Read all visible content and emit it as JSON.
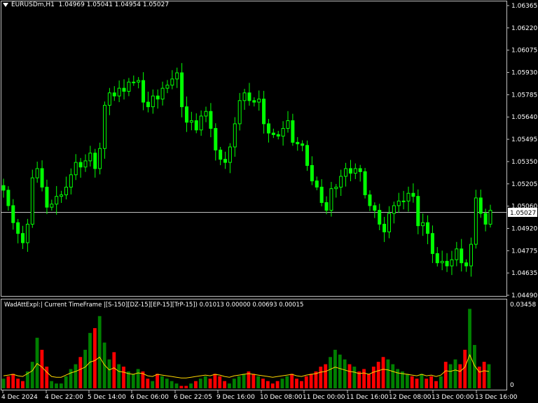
{
  "header": {
    "symbol_label": "EURUSDm,H1",
    "ohlc": "1.04969 1.05041 1.04954 1.05027"
  },
  "indicator_header": "WadAttExpl:| Current TimeFrame |[S-150][DZ-15][EP-15][TrP-15]) 0.01013 0.00000 0.00693 0.00015",
  "price_axis": {
    "labels": [
      "1.06365",
      "1.06220",
      "1.06075",
      "1.05930",
      "1.05785",
      "1.05640",
      "1.05495",
      "1.05350",
      "1.05205",
      "1.05060",
      "1.04920",
      "1.04775",
      "1.04635",
      "1.04490"
    ],
    "current_price": "1.05027"
  },
  "indicator_axis": {
    "top": "0.03458",
    "bottom": "0"
  },
  "time_axis": [
    "4 Dec 2024",
    "4 Dec 22:00",
    "5 Dec 14:00",
    "6 Dec 06:00",
    "6 Dec 22:05",
    "9 Dec 16:00",
    "10 Dec 08:00",
    "11 Dec 00:00",
    "11 Dec 16:00",
    "12 Dec 08:00",
    "13 Dec 00:00",
    "13 Dec 16:00"
  ],
  "colors": {
    "background": "#000000",
    "candle": "#00ff00",
    "bar_up": "#008000",
    "bar_down": "#ff0000",
    "signal_line": "#ffd700",
    "grid_line": "#c0c0c0"
  },
  "chart_data": [
    {
      "type": "line",
      "title": "EURUSDm,H1",
      "x_range": [
        "4 Dec 2024",
        "13 Dec 16:00"
      ],
      "ylim": [
        1.0449,
        1.06365
      ],
      "series": [
        {
          "values": [
            1.0517,
            1.0507,
            1.0496,
            1.0489,
            1.0483,
            1.0495,
            1.0525,
            1.0531,
            1.0519,
            1.0506,
            1.0508,
            1.0513,
            1.0514,
            1.0519,
            1.0527,
            1.0535,
            1.0532,
            1.0536,
            1.0541,
            1.0531,
            1.0544,
            1.0572,
            1.058,
            1.0578,
            1.0583,
            1.0581,
            1.0587,
            1.0587,
            1.0588,
            1.0574,
            1.0571,
            1.0578,
            1.0576,
            1.0583,
            1.0585,
            1.0589,
            1.0593,
            1.0571,
            1.0561,
            1.0562,
            1.0556,
            1.0565,
            1.0568,
            1.0557,
            1.0543,
            1.0537,
            1.0535,
            1.0545,
            1.056,
            1.0575,
            1.058,
            1.0575,
            1.0574,
            1.0576,
            1.056,
            1.0554,
            1.0553,
            1.0552,
            1.0557,
            1.0562,
            1.0548,
            1.0547,
            1.0546,
            1.0533,
            1.0523,
            1.0519,
            1.0509,
            1.0504,
            1.0518,
            1.0519,
            1.0526,
            1.0531,
            1.0528,
            1.0531,
            1.0529,
            1.0514,
            1.0507,
            1.0504,
            1.0495,
            1.049,
            1.0502,
            1.0507,
            1.051,
            1.051,
            1.0515,
            1.0513,
            1.0494,
            1.0496,
            1.0489,
            1.0476,
            1.047,
            1.0471,
            1.0468,
            1.0472,
            1.0479,
            1.047,
            1.0468,
            1.0482,
            1.0512,
            1.0502,
            1.0495,
            1.0504
          ]
        }
      ]
    },
    {
      "type": "bar",
      "title": "WadAttExpl",
      "ylim": [
        0,
        0.03458
      ],
      "series": [
        {
          "name": "up",
          "values": [
            0.004,
            0.005,
            0.006,
            0.004,
            0.003,
            0.007,
            0.011,
            0.021,
            0.016,
            0.009,
            0.003,
            0.002,
            0.002,
            0.005,
            0.008,
            0.01,
            0.013,
            0.016,
            0.023,
            0.025,
            0.03,
            0.019,
            0.012,
            0.015,
            0.01,
            0.009,
            0.007,
            0.006,
            0.008,
            0.007,
            0.004,
            0.003,
            0.006,
            0.005,
            0.004,
            0.003,
            0.002,
            0.001,
            0.001,
            0.002,
            0.003,
            0.004,
            0.005,
            0.004,
            0.006,
            0.005,
            0.003,
            0.002,
            0.004,
            0.005,
            0.006,
            0.007,
            0.006,
            0.005,
            0.004,
            0.003,
            0.002,
            0.003,
            0.004,
            0.005,
            0.006,
            0.004,
            0.003,
            0.005,
            0.006,
            0.007,
            0.009,
            0.01,
            0.013,
            0.016,
            0.014,
            0.012,
            0.01,
            0.009,
            0.007,
            0.008,
            0.006,
            0.009,
            0.011,
            0.013,
            0.012,
            0.01,
            0.008,
            0.007,
            0.006,
            0.005,
            0.004,
            0.006,
            0.004,
            0.005,
            0.003,
            0.005,
            0.011,
            0.01,
            0.012,
            0.01,
            0.016,
            0.033,
            0.018,
            0.009,
            0.011,
            0.01
          ]
        },
        {
          "name": "down",
          "values": [
            0.0,
            0.0,
            0.0,
            0.0,
            0.0,
            0.0,
            0.0,
            0.0,
            0.0,
            0.0,
            0.0,
            0.0,
            0.0,
            0.0,
            0.0,
            0.0,
            0.0,
            0.0,
            0.0,
            0.0,
            0.0,
            0.0,
            0.0,
            0.0,
            0.0,
            0.0,
            0.0,
            0.0,
            0.0,
            0.0,
            0.0,
            0.0,
            0.0,
            0.0,
            0.0,
            0.0,
            0.0,
            0.0,
            0.0,
            0.0,
            0.0,
            0.0,
            0.0,
            0.0,
            0.0,
            0.0,
            0.0,
            0.0,
            0.0,
            0.0,
            0.0,
            0.0,
            0.0,
            0.0,
            0.0,
            0.0,
            0.0,
            0.0,
            0.0,
            0.0,
            0.0,
            0.0,
            0.0,
            0.0,
            0.0,
            0.0,
            0.0,
            0.0,
            0.0,
            0.0,
            0.0,
            0.0,
            0.0,
            0.0,
            0.0,
            0.0,
            0.0,
            0.0,
            0.0,
            0.0,
            0.0,
            0.0,
            0.0,
            0.0,
            0.0,
            0.0,
            0.0,
            0.0,
            0.0,
            0.0,
            0.0,
            0.0,
            0.0,
            0.0,
            0.0,
            0.0,
            0.0,
            0.0,
            0.0,
            0.0,
            0.0,
            0.0
          ]
        }
      ]
    }
  ]
}
